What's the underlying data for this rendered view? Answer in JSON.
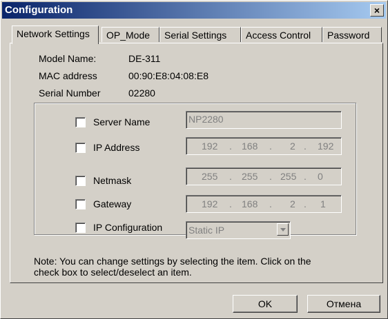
{
  "window": {
    "title": "Configuration",
    "close_glyph": "×"
  },
  "tabs": [
    {
      "label": "Network Settings",
      "active": true
    },
    {
      "label": "OP_Mode",
      "active": false
    },
    {
      "label": "Serial Settings",
      "active": false
    },
    {
      "label": "Access Control",
      "active": false
    },
    {
      "label": "Password",
      "active": false
    }
  ],
  "info": {
    "model_name_label": "Model Name:",
    "model_name_value": "DE-311",
    "mac_label": "MAC address",
    "mac_value": "00:90:E8:04:08:E8",
    "serial_label": "Serial Number",
    "serial_value": "02280"
  },
  "settings": {
    "server_name": {
      "label": "Server Name",
      "checked": false,
      "value": "NP2280"
    },
    "ip_address": {
      "label": "IP Address",
      "checked": false,
      "octets": [
        "192",
        "168",
        "2",
        "192"
      ]
    },
    "netmask": {
      "label": "Netmask",
      "checked": false,
      "octets": [
        "255",
        "255",
        "255",
        "0"
      ]
    },
    "gateway": {
      "label": "Gateway",
      "checked": false,
      "octets": [
        "192",
        "168",
        "2",
        "1"
      ]
    },
    "ip_config": {
      "label": "IP Configuration",
      "checked": false,
      "value": "Static IP"
    }
  },
  "note": {
    "line1": "Note: You can change settings by selecting the item. Click on the",
    "line2": "check box to select/deselect an item."
  },
  "buttons": {
    "ok": "OK",
    "cancel": "Отмена"
  },
  "ip_separator": "."
}
